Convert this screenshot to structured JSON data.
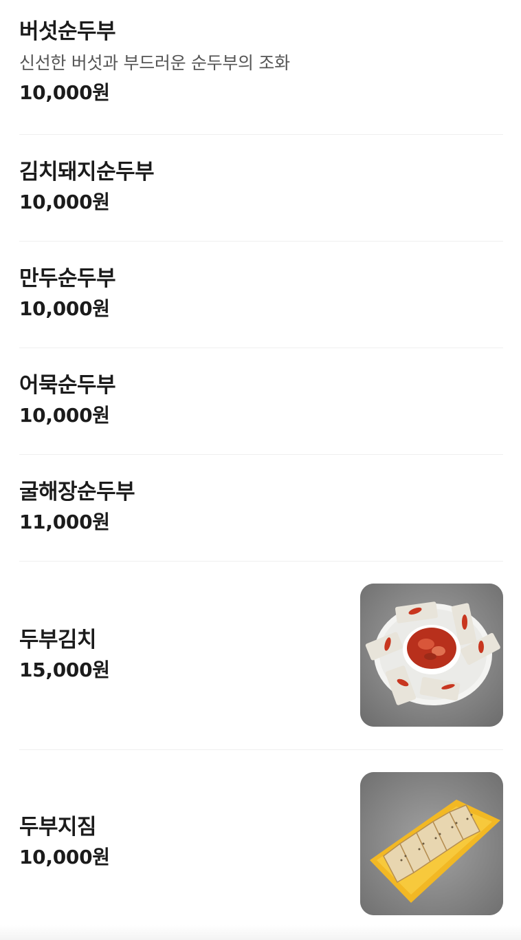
{
  "menu": {
    "items": [
      {
        "name": "버섯순두부",
        "description": "신선한 버섯과 부드러운 순두부의 조화",
        "price": "10,000원"
      },
      {
        "name": "김치돼지순두부",
        "price": "10,000원"
      },
      {
        "name": "만두순두부",
        "price": "10,000원"
      },
      {
        "name": "어묵순두부",
        "price": "10,000원"
      },
      {
        "name": "굴해장순두부",
        "price": "11,000원"
      },
      {
        "name": "두부김치",
        "price": "15,000원",
        "photo": "tofu-kimchi-photo"
      },
      {
        "name": "두부지짐",
        "price": "10,000원",
        "photo": "pan-fried-tofu-photo"
      }
    ]
  },
  "colors": {
    "text": "#1b1b1b",
    "description": "#555555",
    "divider": "#efefef",
    "plate_yellow": "#f2b824",
    "kimchi_red": "#c8361f"
  }
}
